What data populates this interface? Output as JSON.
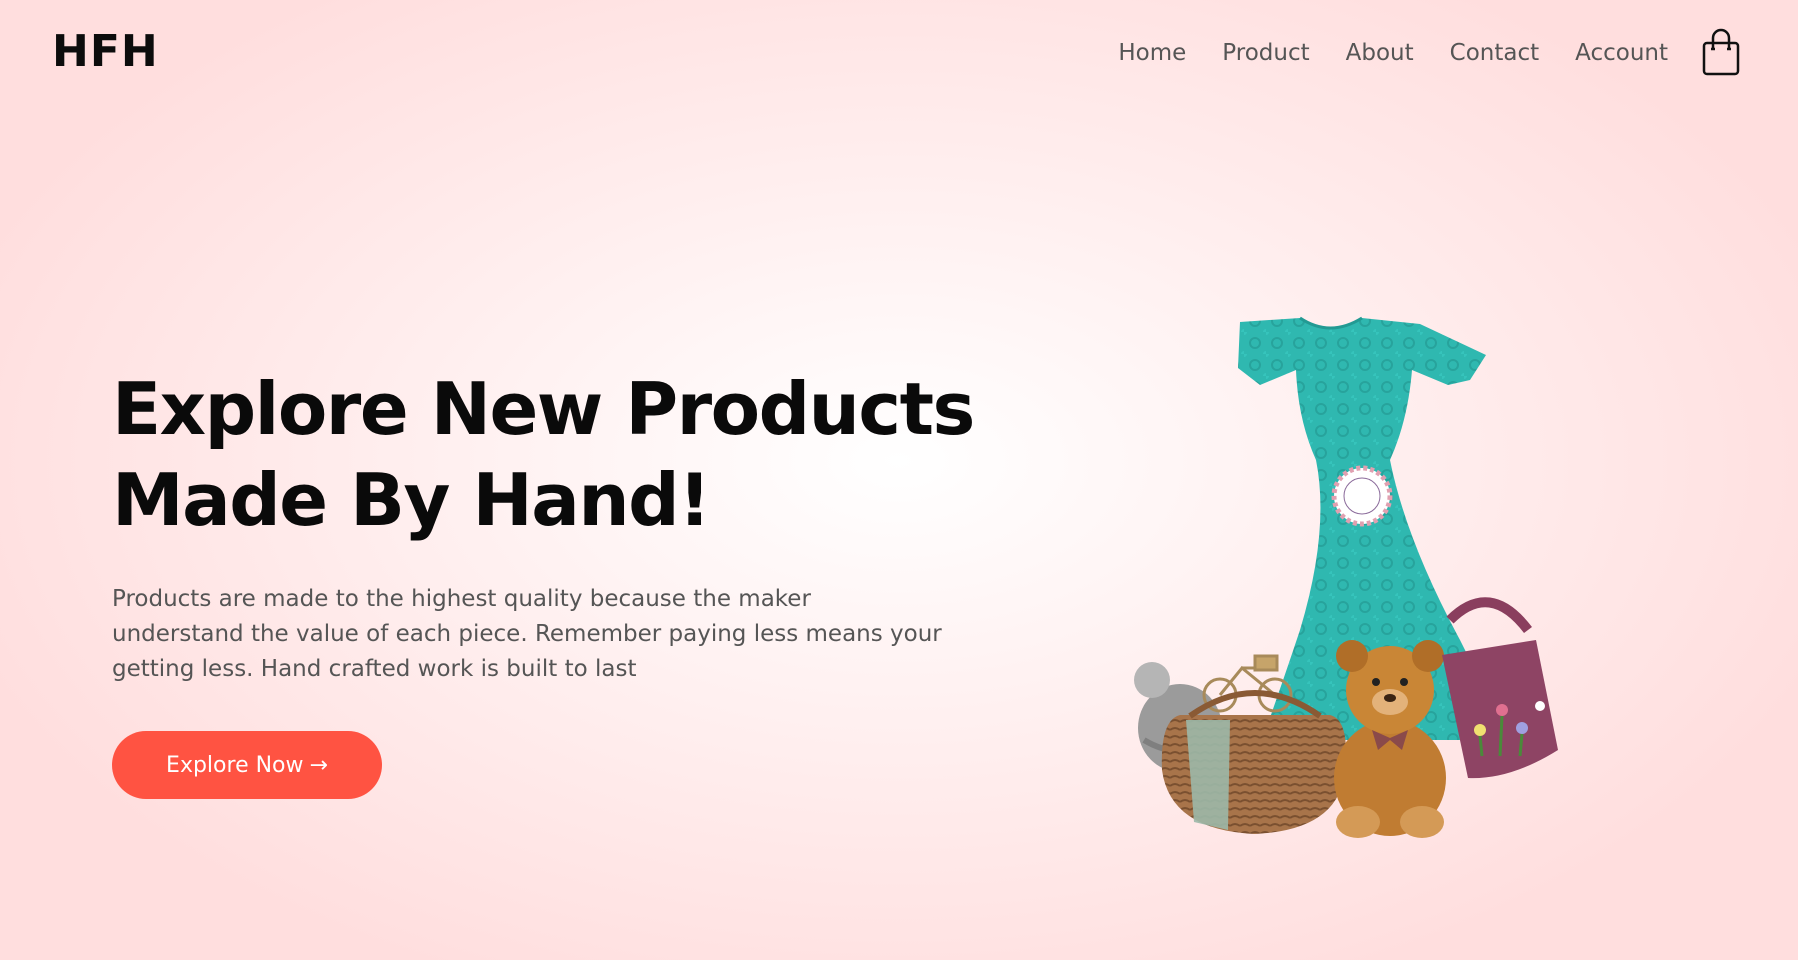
{
  "brand": {
    "logo": "HFH"
  },
  "nav": {
    "items": [
      {
        "label": "Home"
      },
      {
        "label": "Product"
      },
      {
        "label": "About"
      },
      {
        "label": "Contact"
      },
      {
        "label": "Account"
      }
    ],
    "cart_icon": "shopping-bag-icon"
  },
  "hero": {
    "title_line1": "Explore New Products",
    "title_line2": "Made By Hand!",
    "description": "Products are made to the highest quality because the maker understand the value of each piece. Remember paying less means your getting less. Hand crafted work is built to last",
    "cta_label": "Explore Now",
    "cta_arrow": "→",
    "image": {
      "items": [
        "dress",
        "wool-hat",
        "wicker-basket",
        "teddy-bear",
        "knitted-bag",
        "hand-made-badge"
      ]
    }
  },
  "colors": {
    "accent": "#ff5342",
    "dress": "#2fb8b0",
    "background_edge": "#ffdede"
  }
}
